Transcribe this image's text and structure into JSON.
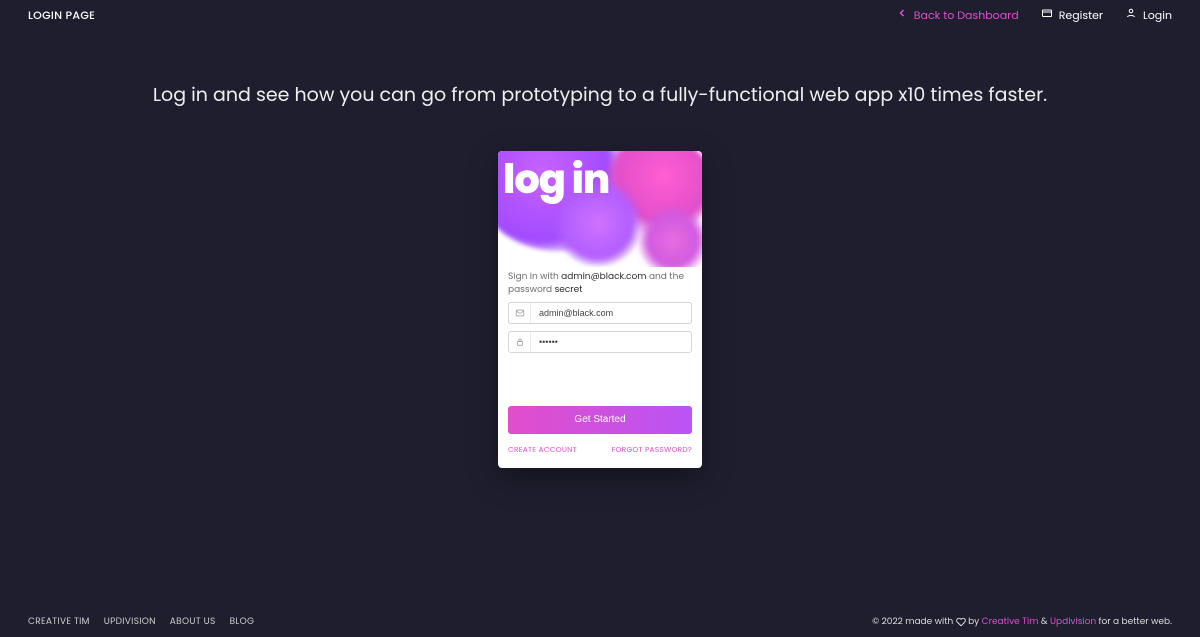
{
  "topbar": {
    "title": "LOGIN PAGE",
    "back_label": "Back to Dashboard",
    "register_label": "Register",
    "login_label": "Login"
  },
  "headline": "Log in and see how you can go from prototyping to a fully-functional web app x10 times faster.",
  "card": {
    "hero_title": "log in",
    "hint_prefix": "Sign in with ",
    "hint_email": "admin@black.com",
    "hint_middle": " and the password ",
    "hint_password": "secret",
    "email_value": "admin@black.com",
    "password_value": "••••••",
    "submit_label": "Get Started",
    "create_account_label": "CREATE ACCOUNT",
    "forgot_password_label": "FORGOT PASSWORD?"
  },
  "footer": {
    "links": {
      "creative_tim": "CREATIVE TIM",
      "updivision": "UPDIVISION",
      "about_us": "ABOUT US",
      "blog": "BLOG"
    },
    "copyright_prefix": "© 2022 made with ",
    "copyright_by": " by ",
    "creative_tim_link": "Creative Tim",
    "and": " & ",
    "updivision_link": "Updivision",
    "copyright_suffix": " for a better web."
  }
}
